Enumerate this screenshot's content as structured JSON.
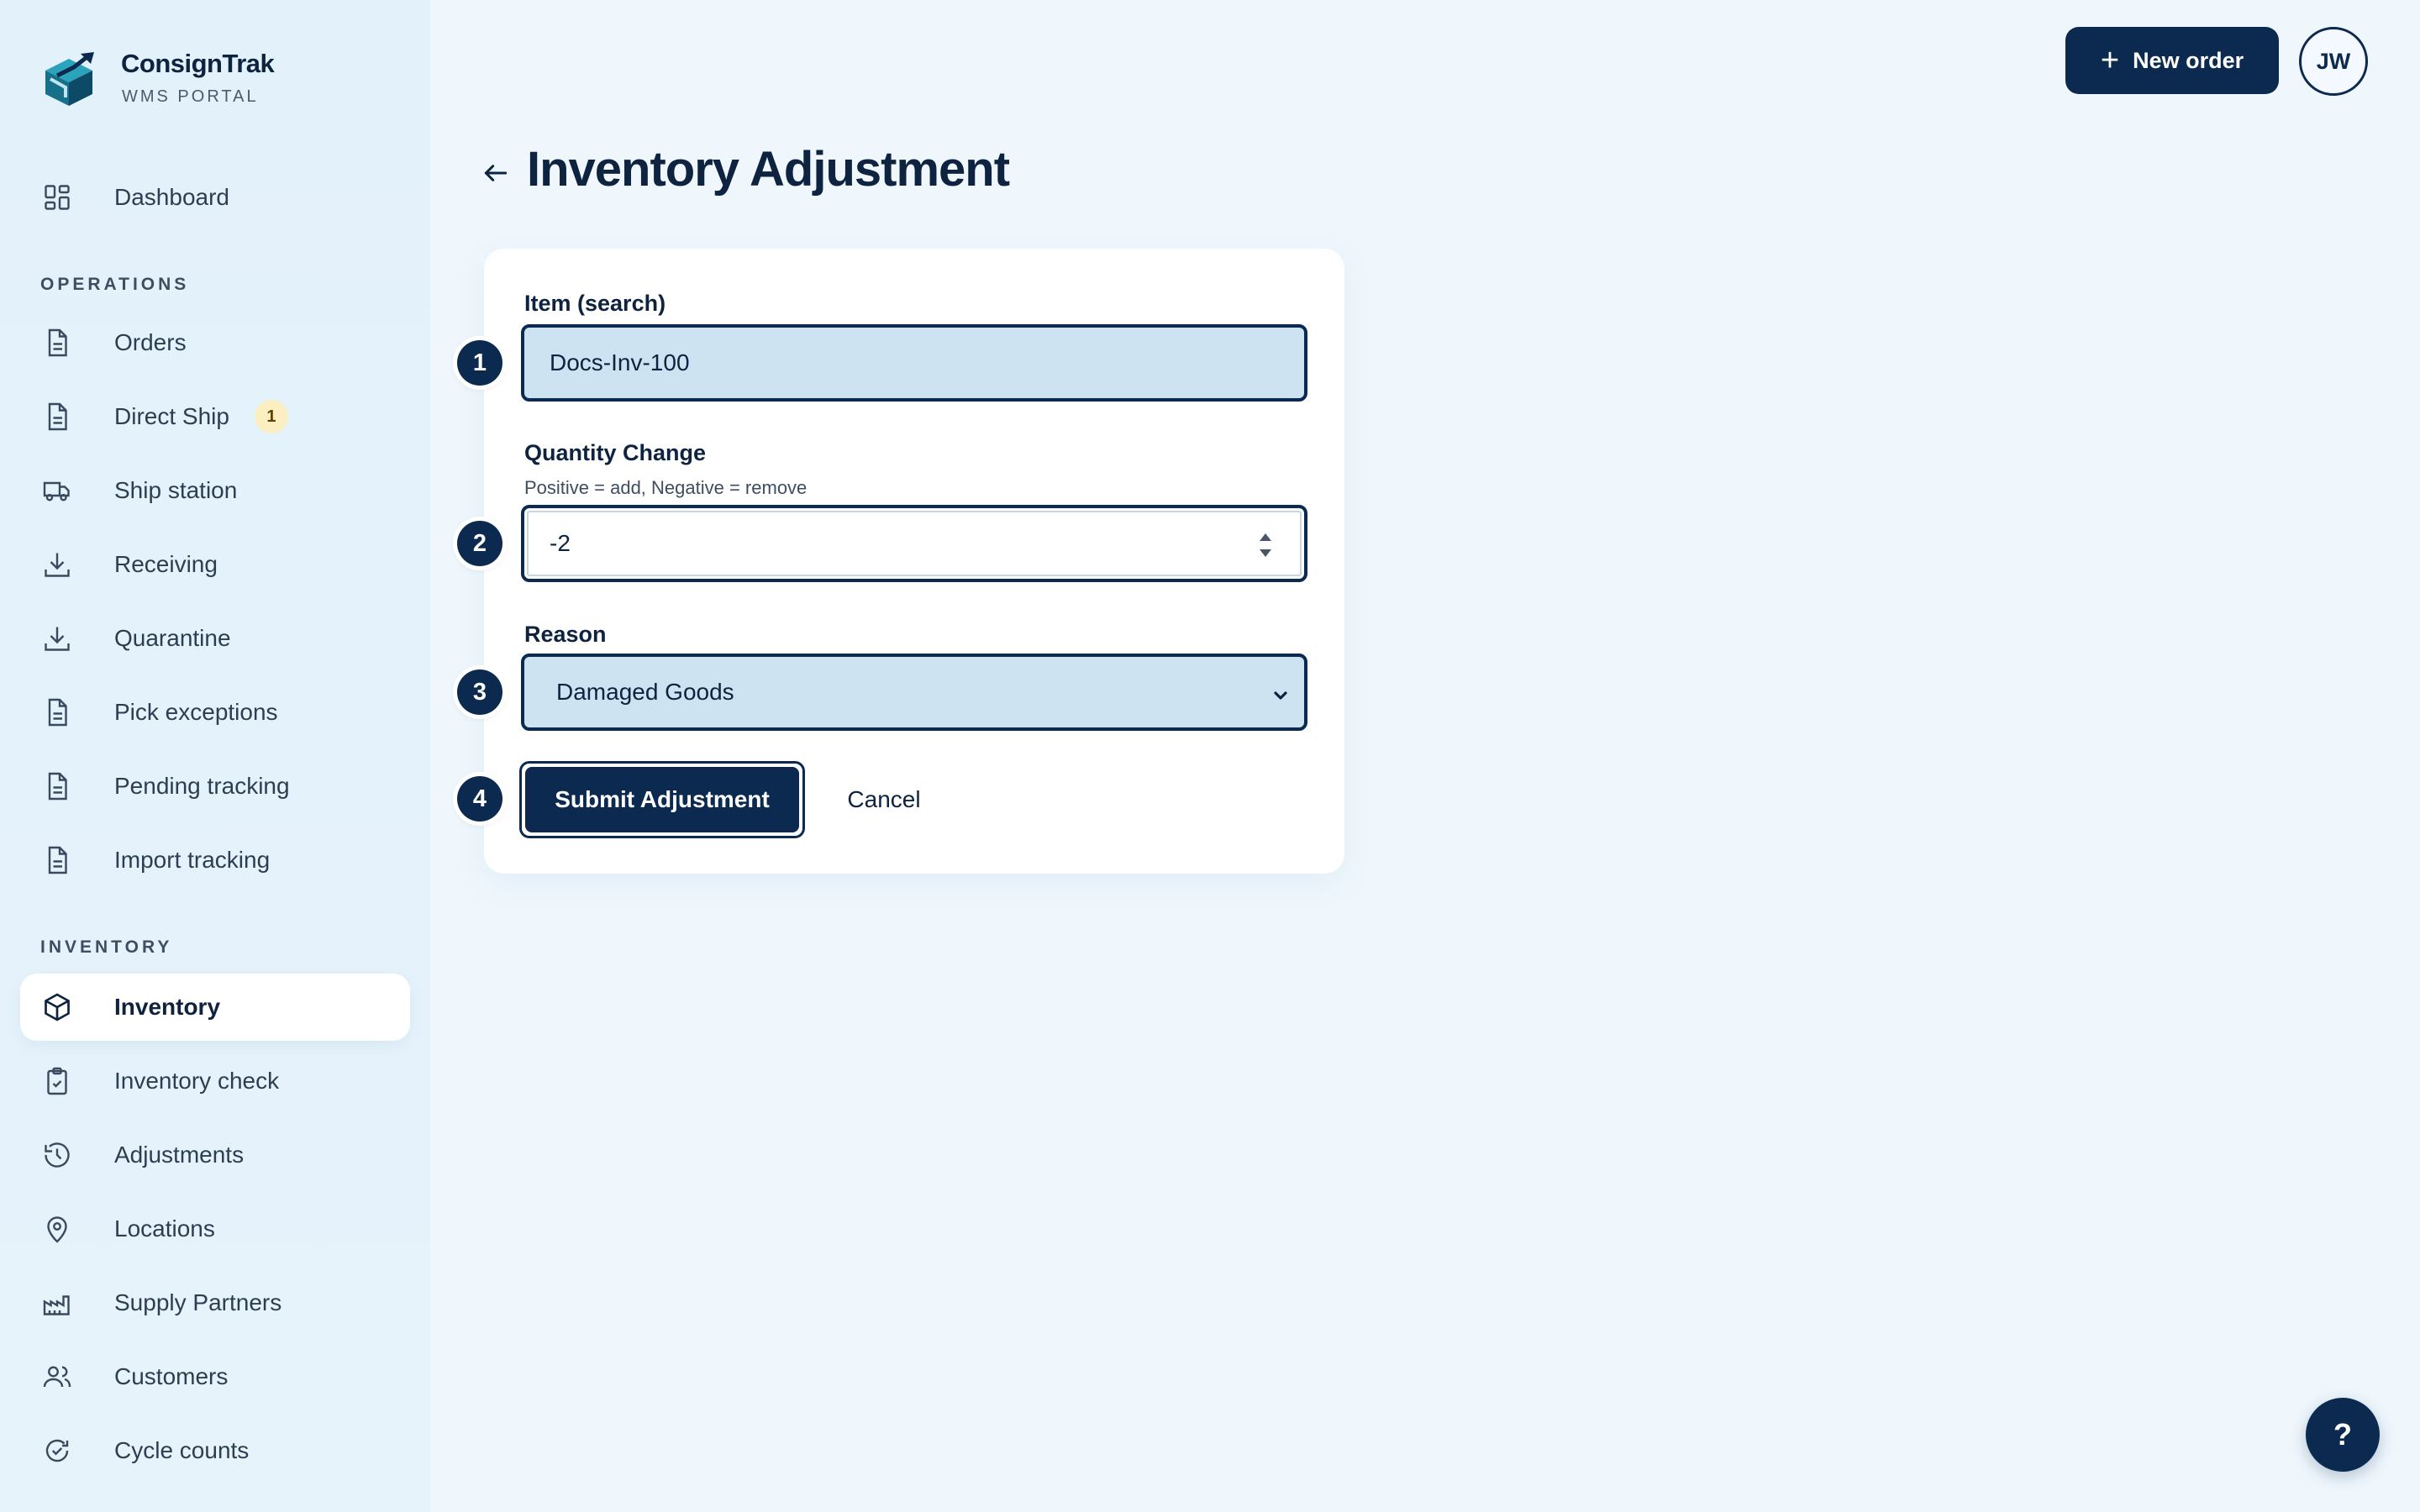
{
  "brand": {
    "name": "ConsignTrak",
    "subtitle": "WMS PORTAL"
  },
  "sidebar": {
    "dashboard": {
      "label": "Dashboard",
      "icon": "grid-icon"
    },
    "sections": [
      {
        "title": "OPERATIONS",
        "items": [
          {
            "label": "Orders",
            "icon": "document-icon"
          },
          {
            "label": "Direct Ship",
            "icon": "document-icon",
            "badge": "1"
          },
          {
            "label": "Ship station",
            "icon": "truck-icon"
          },
          {
            "label": "Receiving",
            "icon": "download-icon"
          },
          {
            "label": "Quarantine",
            "icon": "download-icon"
          },
          {
            "label": "Pick exceptions",
            "icon": "document-icon"
          },
          {
            "label": "Pending tracking",
            "icon": "document-icon"
          },
          {
            "label": "Import tracking",
            "icon": "document-icon"
          }
        ]
      },
      {
        "title": "INVENTORY",
        "items": [
          {
            "label": "Inventory",
            "icon": "cube-icon",
            "active": true
          },
          {
            "label": "Inventory check",
            "icon": "clipboard-check-icon"
          },
          {
            "label": "Adjustments",
            "icon": "history-icon"
          },
          {
            "label": "Locations",
            "icon": "map-pin-icon"
          },
          {
            "label": "Supply Partners",
            "icon": "factory-icon"
          },
          {
            "label": "Customers",
            "icon": "users-icon"
          },
          {
            "label": "Cycle counts",
            "icon": "refresh-check-icon"
          }
        ]
      }
    ]
  },
  "header": {
    "new_order_label": "New order",
    "avatar_initials": "JW"
  },
  "page": {
    "title": "Inventory Adjustment"
  },
  "form": {
    "item": {
      "step": "1",
      "label": "Item (search)",
      "value": "Docs-Inv-100"
    },
    "quantity": {
      "step": "2",
      "label": "Quantity Change",
      "hint": "Positive = add, Negative = remove",
      "value": "-2"
    },
    "reason": {
      "step": "3",
      "label": "Reason",
      "value": "Damaged Goods"
    },
    "actions": {
      "step": "4",
      "submit_label": "Submit Adjustment",
      "cancel_label": "Cancel"
    }
  },
  "help_label": "?",
  "colors": {
    "primary": "#0c2a4f",
    "background": "#eff7fd",
    "field_fill": "#cde3f2",
    "badge": "#fbeec0",
    "logo": "#1d8aa3"
  }
}
